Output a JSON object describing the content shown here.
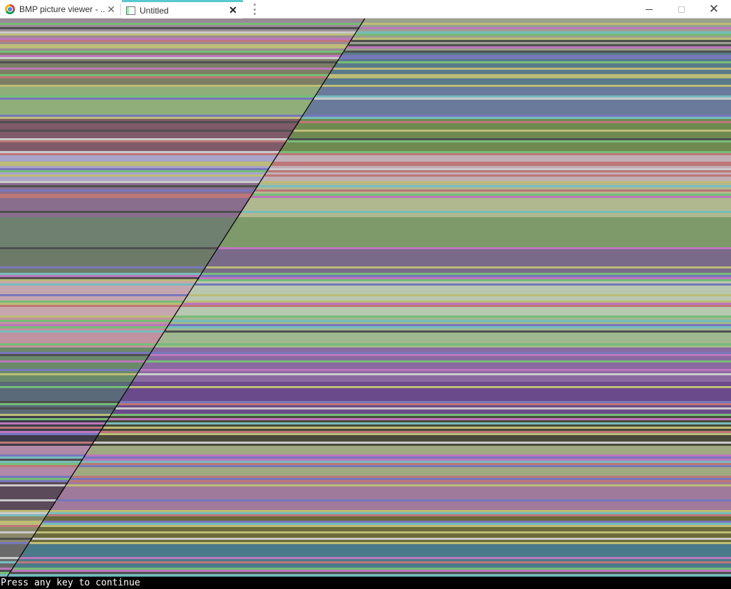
{
  "tabs": [
    {
      "label": "BMP picture viewer - ...",
      "active": false,
      "icon": "chrome-icon"
    },
    {
      "label": "Untitled",
      "active": true,
      "icon": "window-icon"
    }
  ],
  "window_controls": {
    "minimize": "minimize-icon",
    "maximize": "maximize-icon",
    "close": "close-icon"
  },
  "canvas": {
    "description_colors": {
      "accent": "#5ac8cf",
      "diagonal_line": "#000000"
    }
  },
  "console": {
    "text": "Press any key to continue"
  }
}
